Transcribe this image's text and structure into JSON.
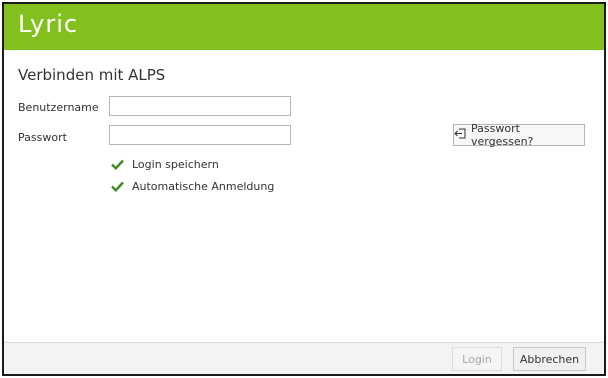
{
  "app": {
    "logo_text": "Lyric",
    "brand_color": "#82c01e"
  },
  "dialog": {
    "title": "Verbinden mit ALPS"
  },
  "form": {
    "username_label": "Benutzername",
    "username_value": "",
    "password_label": "Passwort",
    "password_value": "",
    "forgot_password_label": "Passwort vergessen?",
    "forgot_password_icon": "sign-in-arrow-icon"
  },
  "options": [
    {
      "label": "Login speichern",
      "checked": true
    },
    {
      "label": "Automatische Anmeldung",
      "checked": true
    }
  ],
  "footer": {
    "login_label": "Login",
    "cancel_label": "Abbrechen"
  }
}
